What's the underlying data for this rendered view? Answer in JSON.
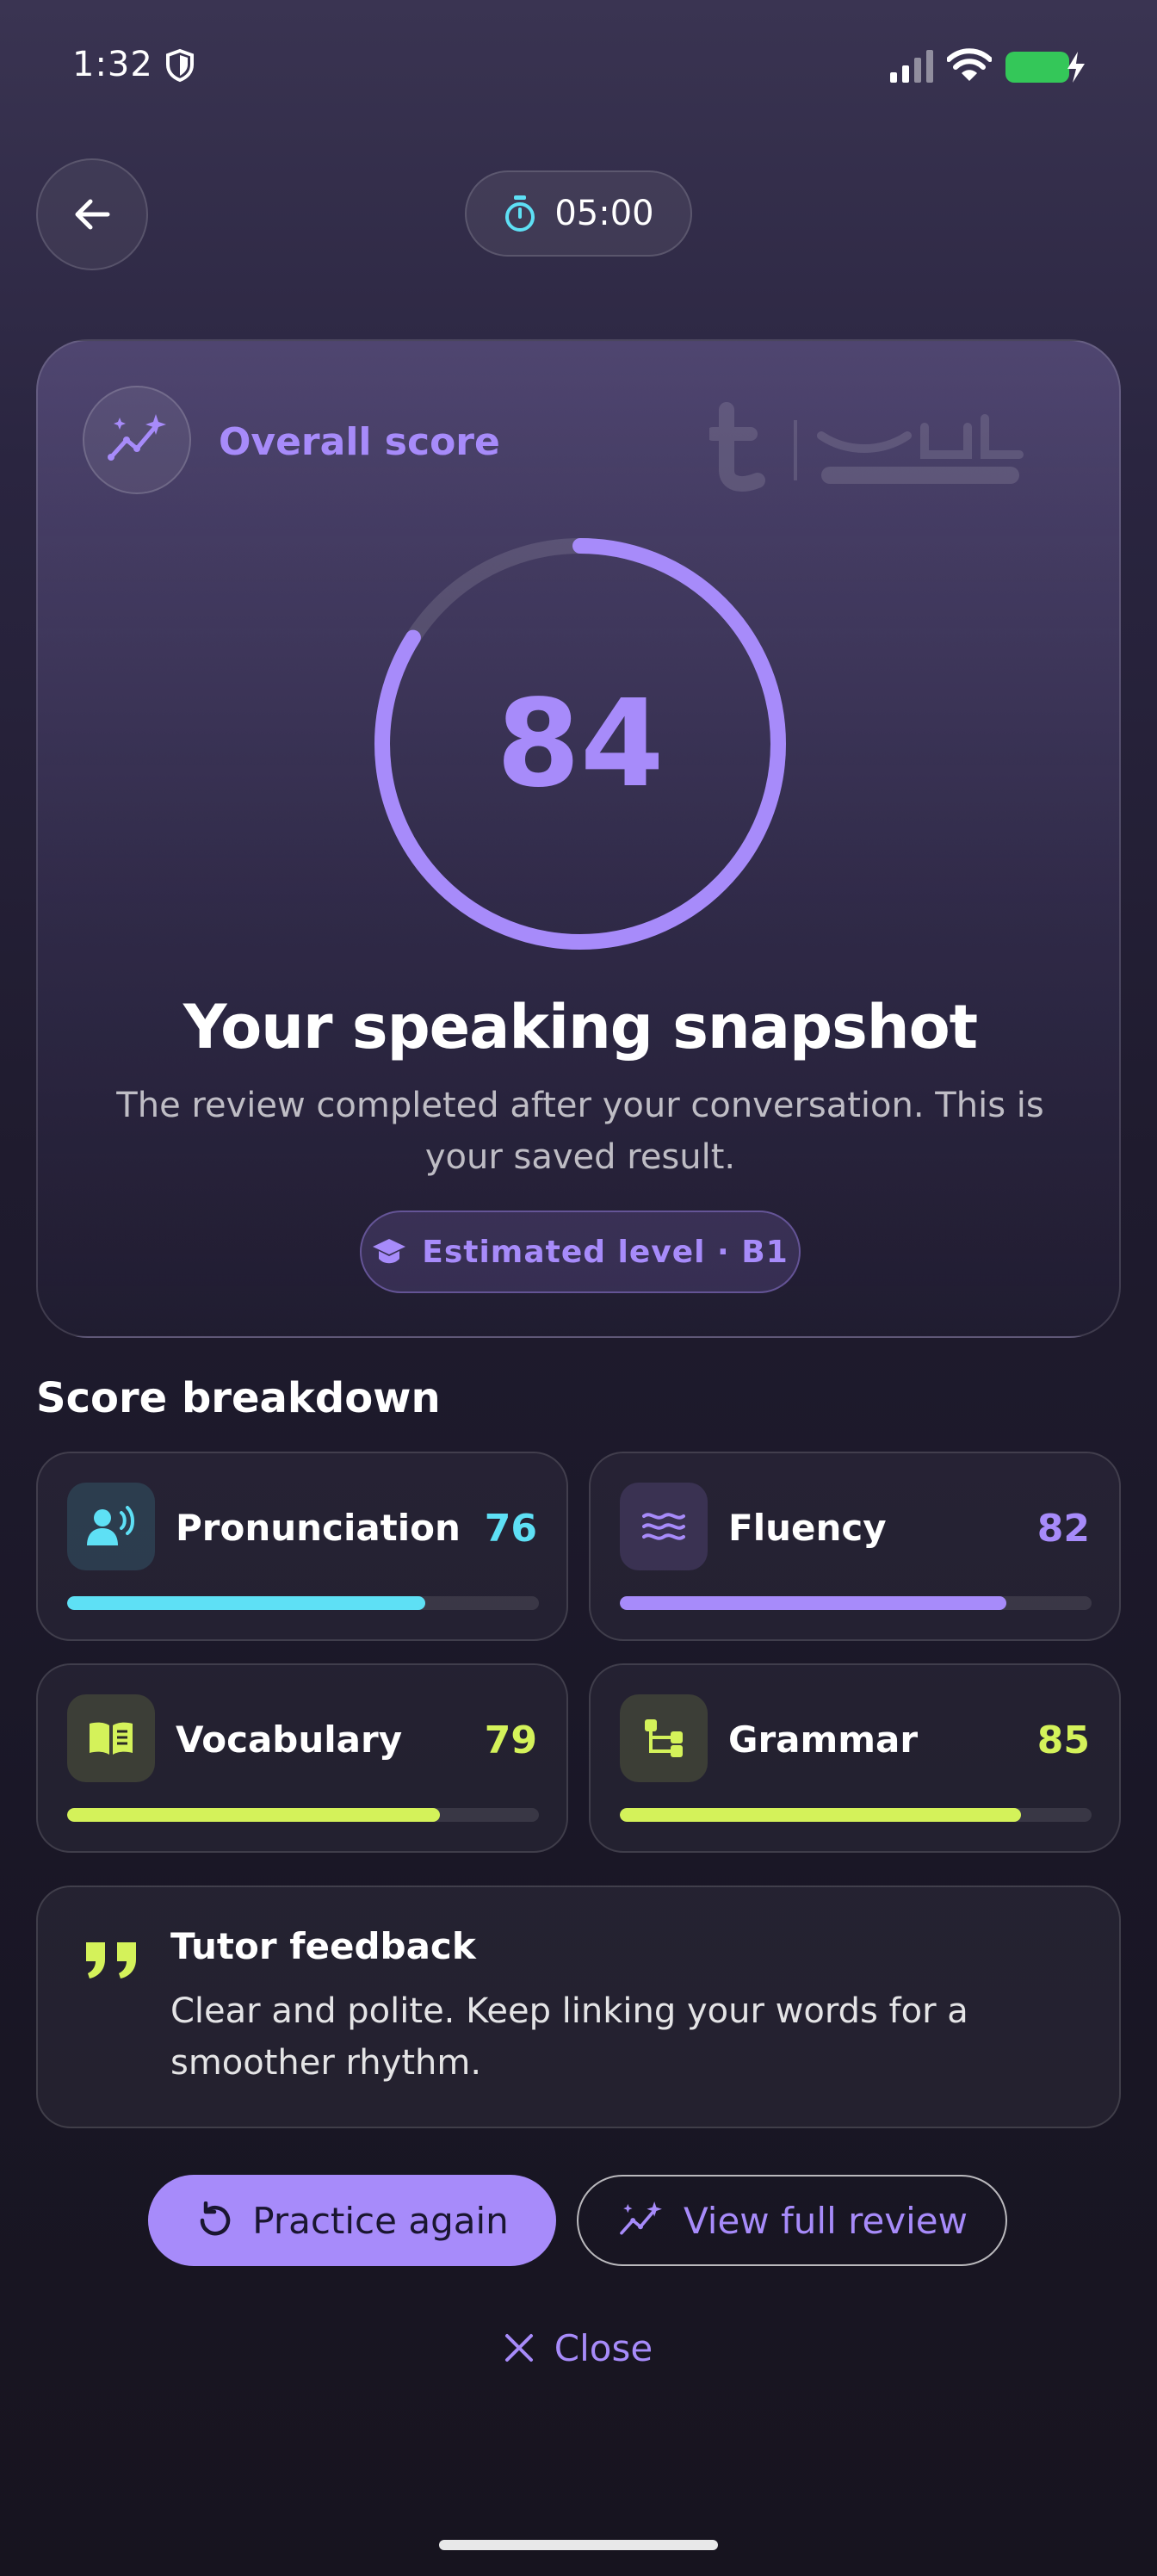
{
  "status_bar": {
    "time": "1:32"
  },
  "header": {
    "timer": "05:00"
  },
  "score_card": {
    "label": "Overall score",
    "score": "84",
    "score_fraction": 0.84,
    "title": "Your speaking snapshot",
    "subtitle": "The review completed after your conversation. This is your saved result.",
    "level": "Estimated level · B1"
  },
  "breakdown": {
    "title": "Score breakdown",
    "items": [
      {
        "label": "Pronunciation",
        "value": "76",
        "percent": 76,
        "color": "#5ee0f5",
        "icon": "speaker-icon"
      },
      {
        "label": "Fluency",
        "value": "82",
        "percent": 82,
        "color": "#a78bfa",
        "icon": "waves-icon"
      },
      {
        "label": "Vocabulary",
        "value": "79",
        "percent": 79,
        "color": "#d4f25a",
        "icon": "book-icon"
      },
      {
        "label": "Grammar",
        "value": "85",
        "percent": 85,
        "color": "#d4f25a",
        "icon": "structure-icon"
      }
    ]
  },
  "feedback": {
    "title": "Tutor feedback",
    "body": "Clear and polite. Keep linking your words for a smoother rhythm."
  },
  "actions": {
    "practice": "Practice again",
    "review": "View full review",
    "close": "Close"
  },
  "colors": {
    "accent": "#a78bfa",
    "cyan": "#5ee0f5",
    "lime": "#d4f25a"
  }
}
